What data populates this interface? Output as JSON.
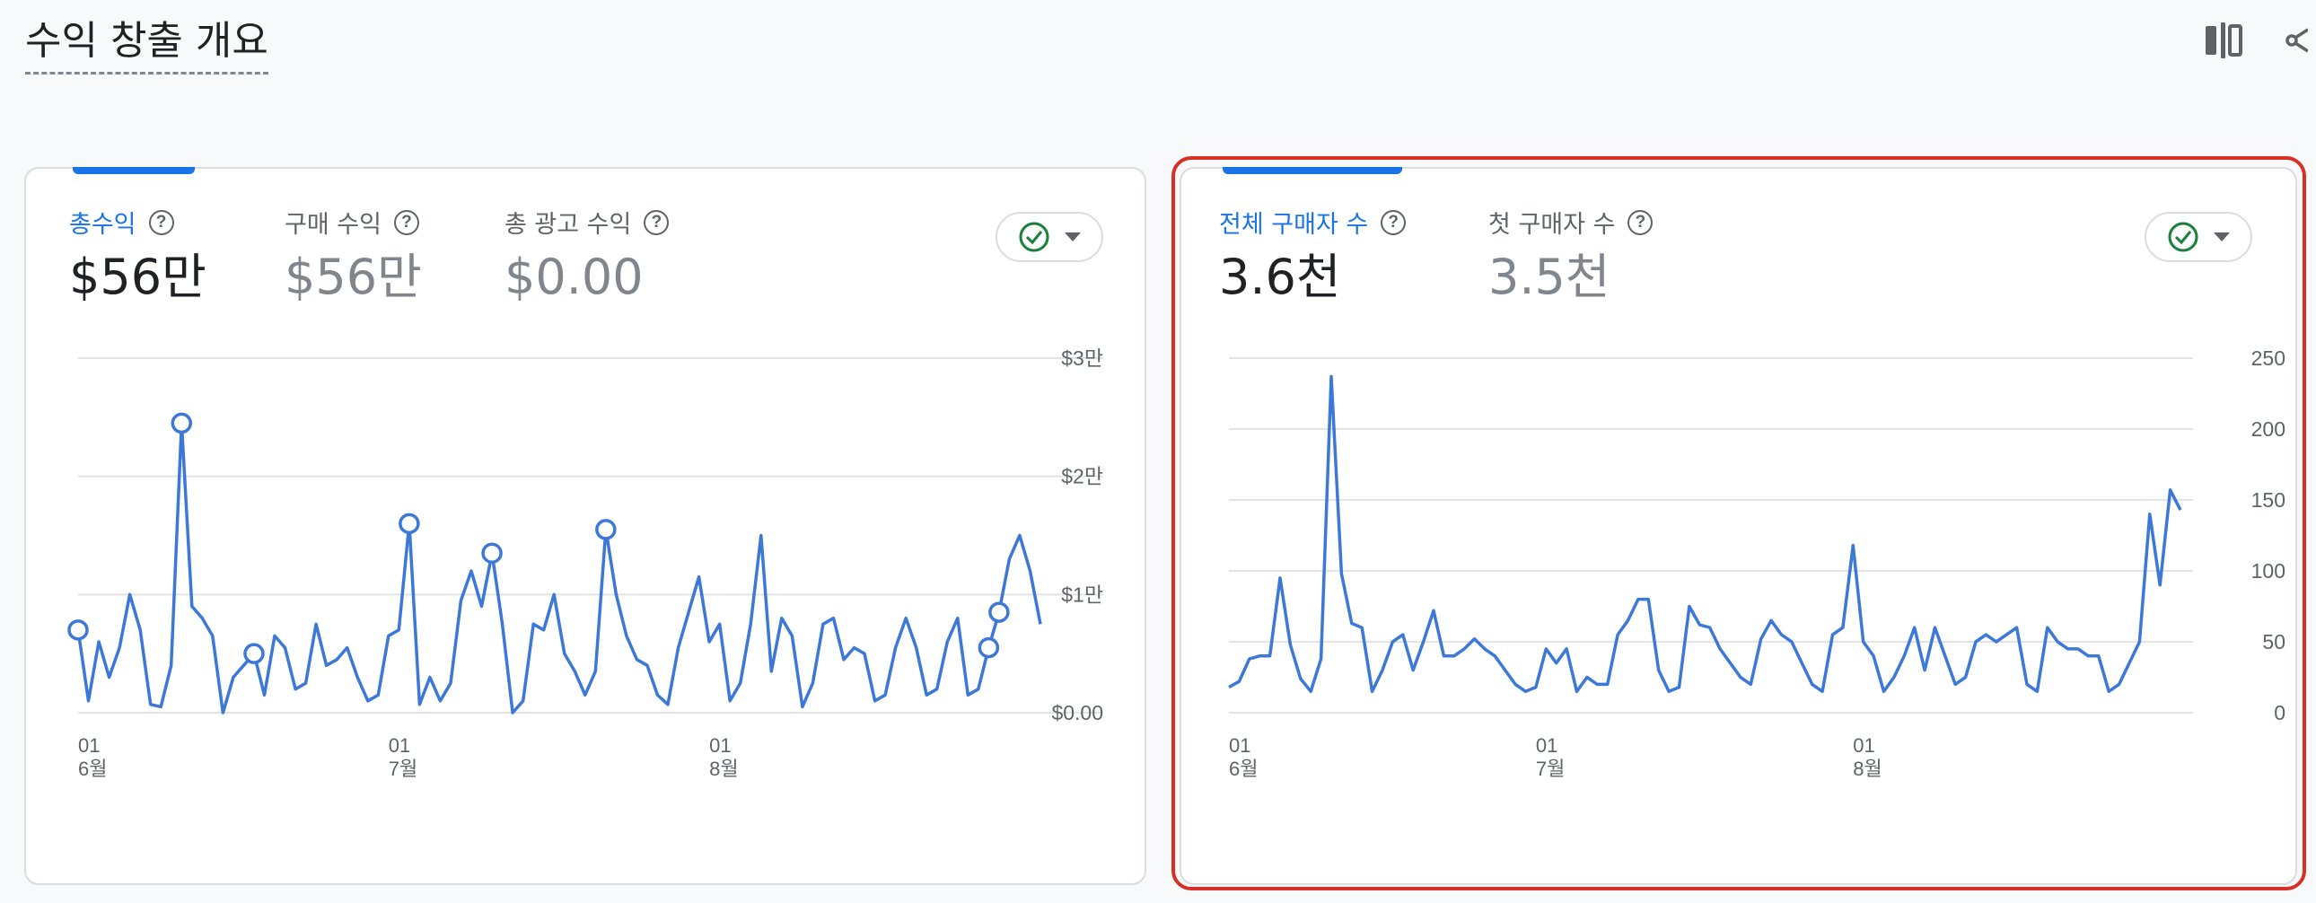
{
  "page": {
    "title": "수익 창출 개요"
  },
  "toolbar": {
    "compare_icon": "compare-columns-icon",
    "share_icon": "share-icon"
  },
  "cards": [
    {
      "metrics": [
        {
          "label": "총수익",
          "value": "$56만",
          "active": true
        },
        {
          "label": "구매 수익",
          "value": "$56만",
          "active": false
        },
        {
          "label": "총 광고 수익",
          "value": "$0.00",
          "active": false
        }
      ],
      "status_icon": "check-circle-icon"
    },
    {
      "metrics": [
        {
          "label": "전체 구매자 수",
          "value": "3.6천",
          "active": true
        },
        {
          "label": "첫 구매자 수",
          "value": "3.5천",
          "active": false
        }
      ],
      "status_icon": "check-circle-icon"
    }
  ],
  "colors": {
    "accent": "#1a73e8",
    "line": "#3c78d8",
    "highlight": "#d93025",
    "check": "#188038"
  },
  "chart_data": [
    {
      "type": "line",
      "y_unit": "USD",
      "ylim": [
        0,
        30000
      ],
      "y_tick_values": [
        0,
        10000,
        20000,
        30000
      ],
      "y_tick_labels": [
        "$0.00",
        "$1만",
        "$2만",
        "$3만"
      ],
      "x_tick_indices": [
        0,
        30,
        61
      ],
      "x_tick_labels": [
        [
          "01",
          "6월"
        ],
        [
          "01",
          "7월"
        ],
        [
          "01",
          "8월"
        ]
      ],
      "grid": true,
      "series": [
        {
          "values": [
            7000,
            1000,
            6000,
            3000,
            5500,
            10000,
            7000,
            700,
            500,
            4000,
            24500,
            9000,
            8000,
            6500,
            0,
            3000,
            4000,
            5000,
            1500,
            6500,
            5500,
            2000,
            2500,
            7500,
            4000,
            4500,
            5500,
            3000,
            1000,
            1500,
            6500,
            7000,
            16000,
            700,
            3000,
            1000,
            2500,
            9500,
            12000,
            9000,
            13500,
            7500,
            0,
            1000,
            7500,
            7000,
            10000,
            5000,
            3500,
            1500,
            3500,
            15500,
            10000,
            6500,
            4500,
            4000,
            1500,
            700,
            5500,
            8500,
            11500,
            6000,
            7500,
            1000,
            2500,
            7500,
            15000,
            3500,
            8000,
            6500,
            500,
            2500,
            7500,
            8000,
            4500,
            5500,
            5000,
            1000,
            1500,
            5500,
            8000,
            5500,
            1500,
            2000,
            6000,
            8000,
            1500,
            2000,
            5500,
            8500,
            13000,
            15000,
            12000,
            7500
          ],
          "anomalies": [
            0,
            10,
            17,
            32,
            40,
            51,
            88,
            89
          ]
        }
      ]
    },
    {
      "type": "line",
      "ylim": [
        0,
        250
      ],
      "y_tick_values": [
        0,
        50,
        100,
        150,
        200,
        250
      ],
      "y_tick_labels": [
        "0",
        "50",
        "100",
        "150",
        "200",
        "250"
      ],
      "x_tick_indices": [
        0,
        30,
        61
      ],
      "x_tick_labels": [
        [
          "01",
          "6월"
        ],
        [
          "01",
          "7월"
        ],
        [
          "01",
          "8월"
        ]
      ],
      "grid": true,
      "series": [
        {
          "values": [
            18,
            22,
            38,
            40,
            40,
            95,
            48,
            24,
            15,
            38,
            237,
            98,
            63,
            60,
            15,
            30,
            50,
            55,
            30,
            50,
            72,
            40,
            40,
            45,
            52,
            45,
            40,
            30,
            20,
            15,
            18,
            45,
            35,
            45,
            15,
            25,
            20,
            20,
            55,
            65,
            80,
            80,
            30,
            15,
            18,
            75,
            62,
            60,
            45,
            35,
            25,
            20,
            52,
            65,
            55,
            50,
            35,
            20,
            15,
            55,
            60,
            118,
            50,
            40,
            15,
            25,
            40,
            60,
            30,
            60,
            40,
            20,
            25,
            50,
            55,
            50,
            55,
            60,
            20,
            15,
            60,
            50,
            45,
            45,
            40,
            40,
            15,
            20,
            35,
            50,
            140,
            90,
            157,
            143
          ]
        }
      ]
    }
  ]
}
